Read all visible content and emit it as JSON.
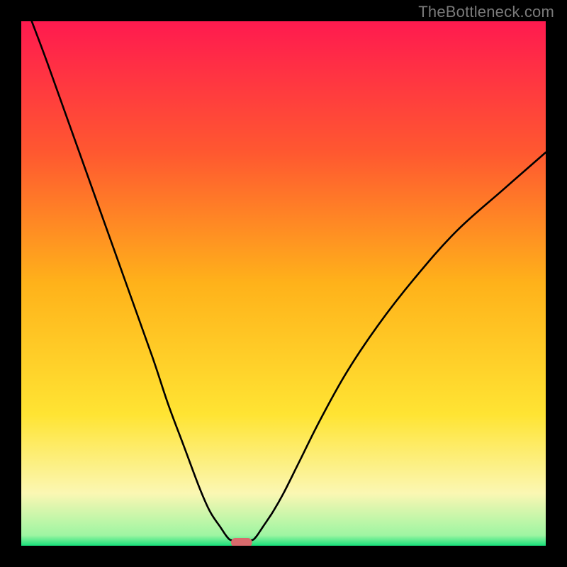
{
  "watermark": "TheBottleneck.com",
  "chart_data": {
    "type": "line",
    "title": "",
    "xlabel": "",
    "ylabel": "",
    "xlim": [
      0,
      100
    ],
    "ylim": [
      0,
      100
    ],
    "series": [
      {
        "name": "curve-left",
        "x": [
          2,
          5,
          10,
          15,
          20,
          25,
          28,
          31,
          34,
          36,
          38,
          39,
          39.7,
          40.3
        ],
        "y": [
          100,
          92,
          78,
          64,
          50,
          36,
          27,
          19,
          11,
          6.5,
          3.5,
          2.0,
          1.2,
          1.0
        ]
      },
      {
        "name": "curve-right",
        "x": [
          43.7,
          44.3,
          45,
          46,
          48,
          50,
          53,
          57,
          62,
          68,
          75,
          83,
          92,
          100
        ],
        "y": [
          1.0,
          1.2,
          2.0,
          3.5,
          6.5,
          10,
          16,
          24,
          33,
          42,
          51,
          60,
          68,
          75
        ]
      }
    ],
    "marker": {
      "name": "sweet-spot",
      "x_range": [
        40,
        44
      ],
      "y": 0.6,
      "color": "#d96b6d"
    },
    "gradient_stops": [
      {
        "y": 100,
        "color": "#ff1a4f"
      },
      {
        "y": 75,
        "color": "#ff5830"
      },
      {
        "y": 50,
        "color": "#ffb21a"
      },
      {
        "y": 25,
        "color": "#ffe433"
      },
      {
        "y": 10,
        "color": "#fbf7b3"
      },
      {
        "y": 2,
        "color": "#9ef5a2"
      },
      {
        "y": 0,
        "color": "#18e07a"
      }
    ],
    "grid": false,
    "legend": false
  }
}
